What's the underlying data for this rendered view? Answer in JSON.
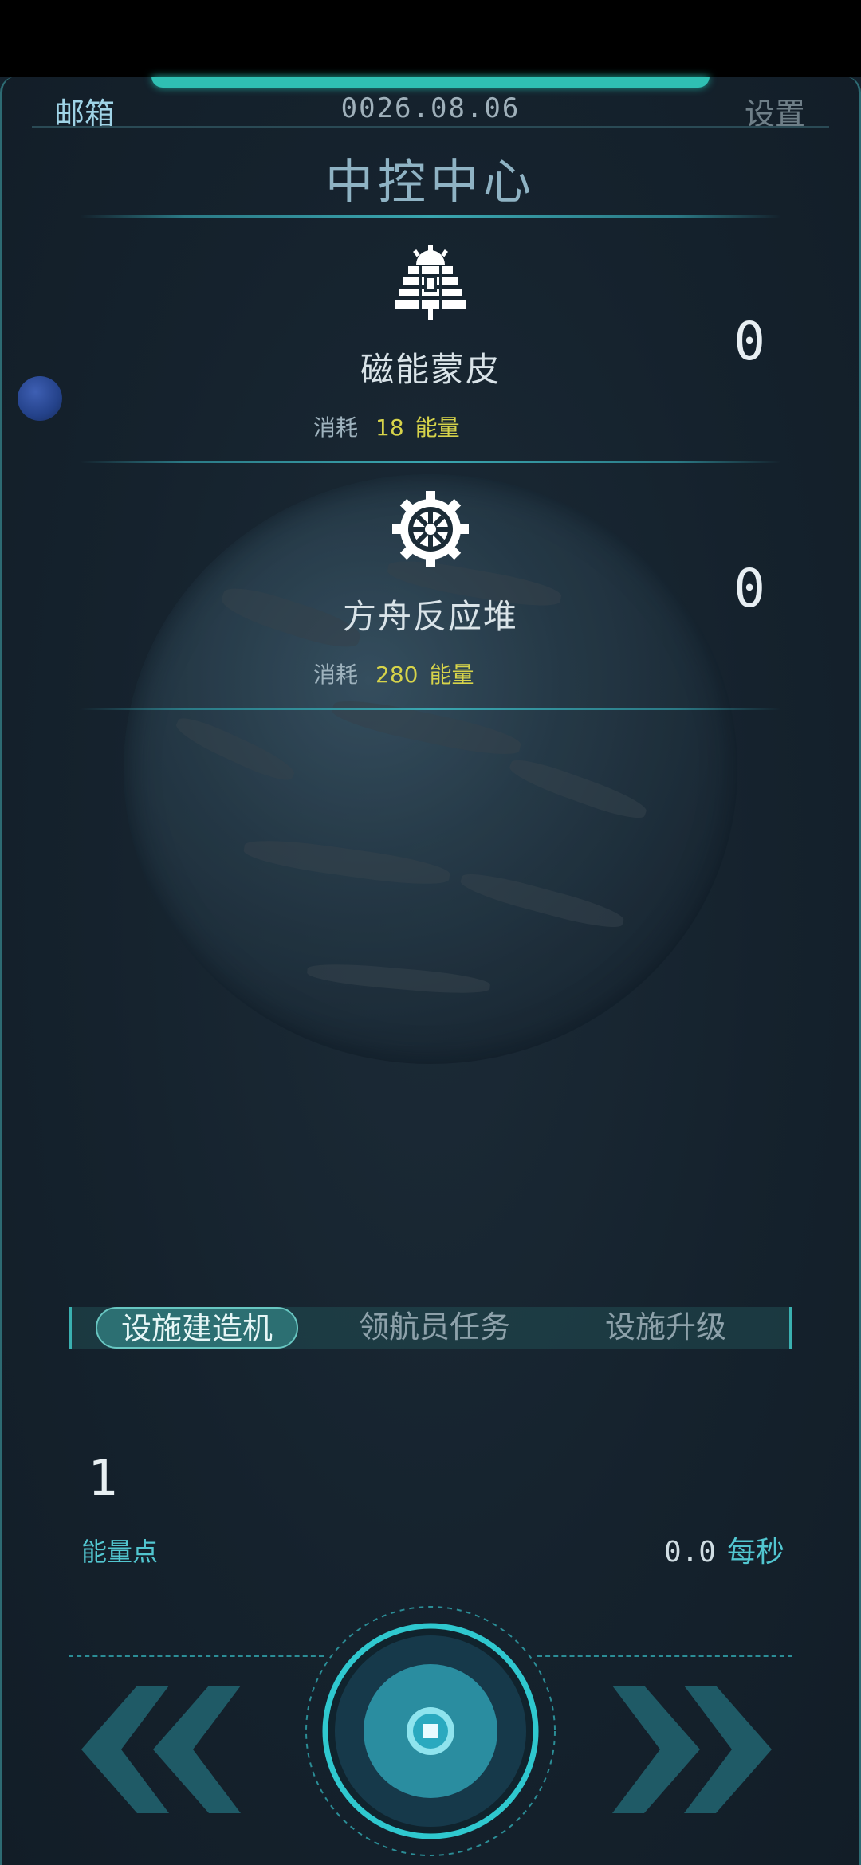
{
  "header": {
    "mail_label": "邮箱",
    "date": "0026.08.06",
    "settings_label": "设置",
    "title": "中控中心"
  },
  "facilities": [
    {
      "name": "磁能蒙皮",
      "cost_label": "消耗",
      "cost_value": "18",
      "cost_unit": "能量",
      "count": "0",
      "icon": "solar-panel-icon"
    },
    {
      "name": "方舟反应堆",
      "cost_label": "消耗",
      "cost_value": "280",
      "cost_unit": "能量",
      "count": "0",
      "icon": "reactor-gear-icon"
    }
  ],
  "tabs": [
    {
      "label": "设施建造机",
      "active": true
    },
    {
      "label": "领航员任务",
      "active": false
    },
    {
      "label": "设施升级",
      "active": false
    }
  ],
  "resources": {
    "energy_points": "1",
    "energy_label": "能量点",
    "rate_value": "0.0",
    "rate_unit": "每秒"
  },
  "controls": {
    "prev_icon": "double-chevron-left-icon",
    "next_icon": "double-chevron-right-icon",
    "core_icon": "core-button-icon"
  },
  "colors": {
    "accent": "#2fbfb3",
    "cost_highlight": "#d6d34a",
    "label_cyan": "#52c6d0",
    "background": "#15222d"
  }
}
